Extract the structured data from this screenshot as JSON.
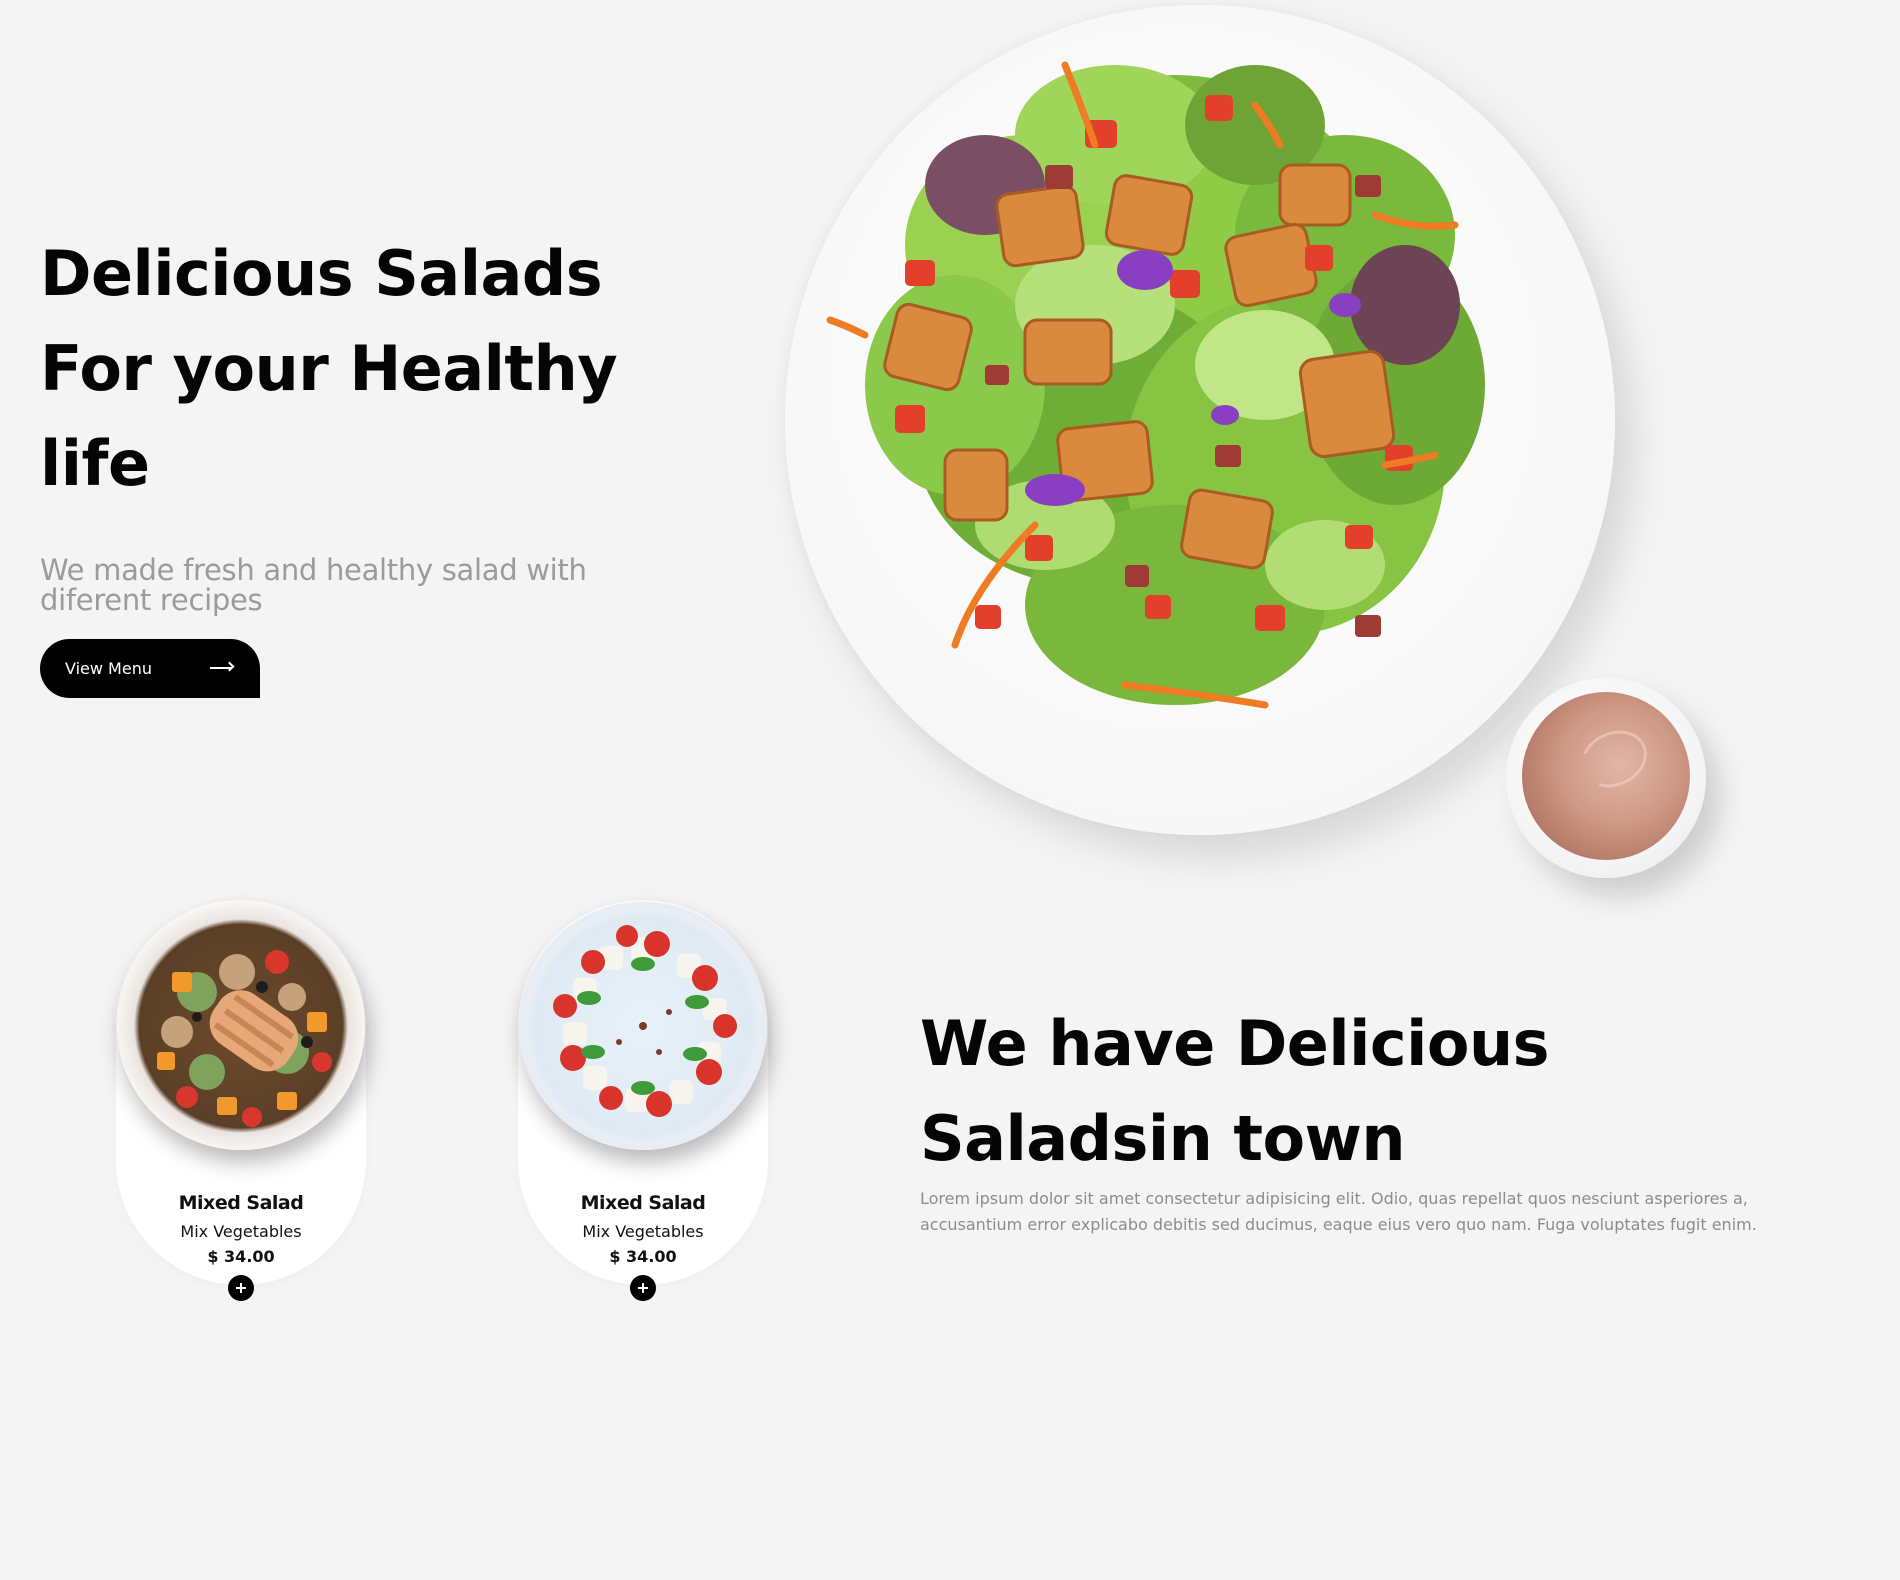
{
  "hero": {
    "title_lines": [
      "Delicious Salads",
      "For your Healthy",
      "life"
    ],
    "subtitle": "We made fresh and healthy salad with diferent recipes",
    "cta_label": "View Menu",
    "cta_icon": "arrow-right-icon"
  },
  "images": {
    "main_dish": "salad-plate-image",
    "side_dip": "dip-bowl-image"
  },
  "products": [
    {
      "name": "Mixed Salad",
      "description": "Mix Vegetables",
      "price": "$ 34.00",
      "image": "salad-bowl-image",
      "add_icon": "plus-icon"
    },
    {
      "name": "Mixed Salad",
      "description": "Mix Vegetables",
      "price": "$ 34.00",
      "image": "caprese-plate-image",
      "add_icon": "plus-icon"
    }
  ],
  "about": {
    "title_lines": [
      "We have Delicious",
      "Saladsin town"
    ],
    "text": "Lorem ipsum dolor sit amet consectetur adipisicing elit. Odio, quas repellat quos nesciunt asperiores a, accusantium error explicabo debitis sed ducimus, eaque eius vero quo nam. Fuga voluptates fugit enim."
  },
  "colors": {
    "background": "#f4f4f4",
    "text": "#050505",
    "muted": "#9b9b9b",
    "button": "#000000",
    "card": "#ffffff"
  }
}
